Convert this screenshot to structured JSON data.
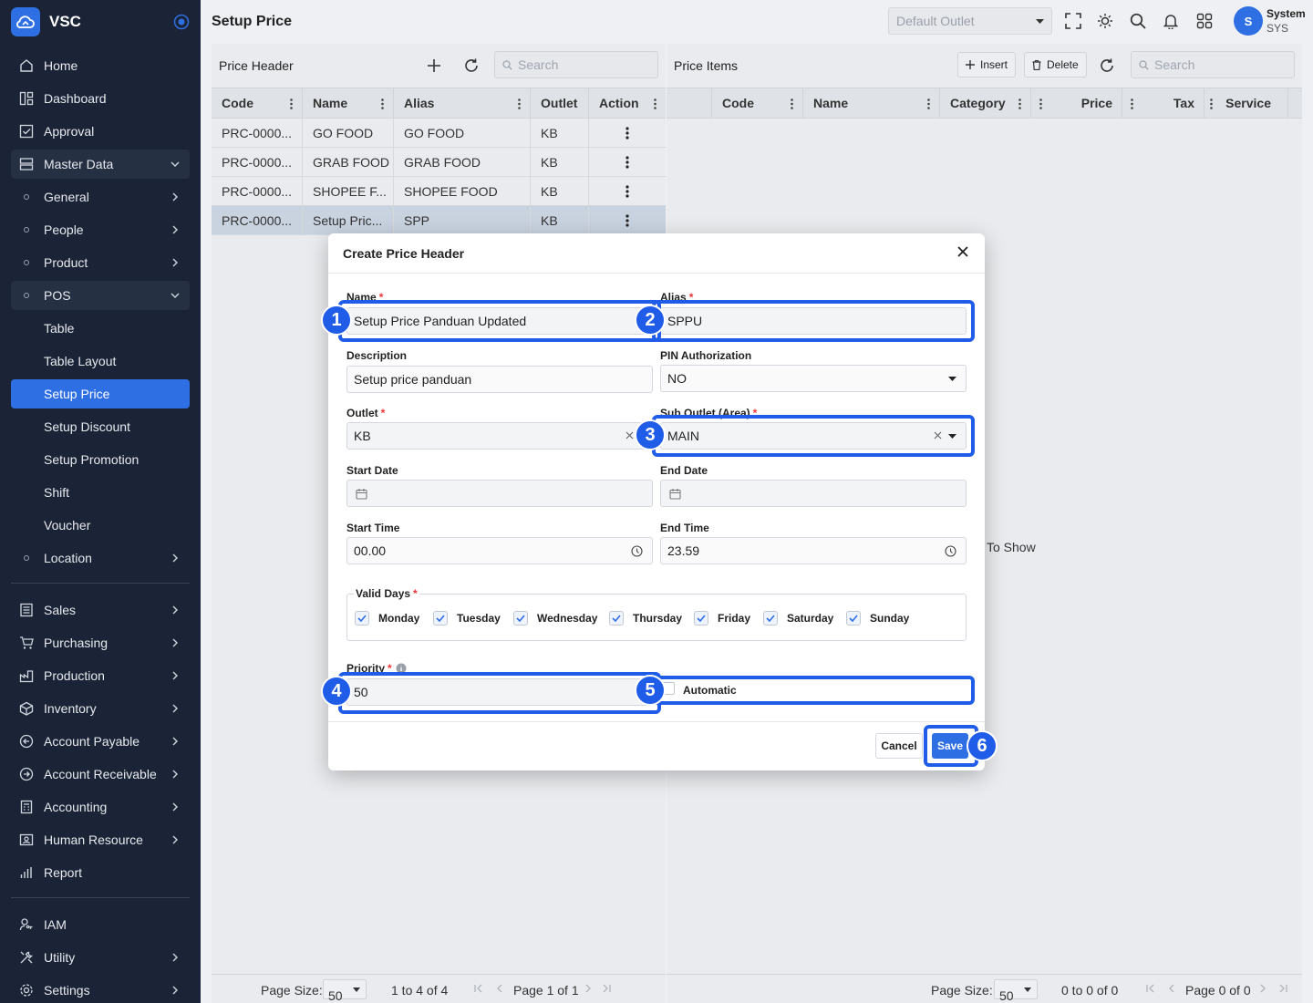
{
  "app": {
    "name": "VSC",
    "page_title": "Setup Price"
  },
  "topbar": {
    "outlet_placeholder": "Default Outlet",
    "user_name": "System",
    "user_code": "SYS",
    "avatar_initial": "S"
  },
  "sidebar": {
    "home": "Home",
    "dashboard": "Dashboard",
    "approval": "Approval",
    "master_data": "Master Data",
    "general": "General",
    "people": "People",
    "product": "Product",
    "pos": "POS",
    "table": "Table",
    "table_layout": "Table Layout",
    "setup_price": "Setup Price",
    "setup_discount": "Setup Discount",
    "setup_promotion": "Setup Promotion",
    "shift": "Shift",
    "voucher": "Voucher",
    "location": "Location",
    "sales": "Sales",
    "purchasing": "Purchasing",
    "production": "Production",
    "inventory": "Inventory",
    "account_payable": "Account Payable",
    "account_receivable": "Account Receivable",
    "accounting": "Accounting",
    "human_resource": "Human Resource",
    "report": "Report",
    "iam": "IAM",
    "utility": "Utility",
    "settings": "Settings"
  },
  "price_header": {
    "title": "Price Header",
    "search_placeholder": "Search",
    "columns": [
      "Code",
      "Name",
      "Alias",
      "Outlet",
      "Action"
    ],
    "rows": [
      {
        "code": "PRC-0000...",
        "name": "GO FOOD",
        "alias": "GO FOOD",
        "outlet": "KB"
      },
      {
        "code": "PRC-0000...",
        "name": "GRAB FOOD",
        "alias": "GRAB FOOD",
        "outlet": "KB"
      },
      {
        "code": "PRC-0000...",
        "name": "SHOPEE F...",
        "alias": "SHOPEE FOOD",
        "outlet": "KB"
      },
      {
        "code": "PRC-0000...",
        "name": "Setup Pric...",
        "alias": "SPP",
        "outlet": "KB"
      }
    ],
    "pager": {
      "page_size_label": "Page Size:",
      "page_size": "50",
      "range": "1 to 4 of 4",
      "page_info": "Page 1 of 1"
    }
  },
  "price_items": {
    "title": "Price Items",
    "insert_label": "Insert",
    "delete_label": "Delete",
    "search_placeholder": "Search",
    "columns": [
      "Code",
      "Name",
      "Category",
      "Price",
      "Tax",
      "Service"
    ],
    "empty_text": "To Show",
    "pager": {
      "page_size_label": "Page Size:",
      "page_size": "50",
      "range": "0 to 0 of 0",
      "page_info": "Page 0 of 0"
    }
  },
  "modal": {
    "title": "Create Price Header",
    "name_label": "Name",
    "name_value": "Setup Price Panduan Updated",
    "alias_label": "Alias",
    "alias_value": "SPPU",
    "description_label": "Description",
    "description_value": "Setup price panduan",
    "pin_label": "PIN Authorization",
    "pin_value": "NO",
    "outlet_label": "Outlet",
    "outlet_value": "KB",
    "sub_outlet_label": "Sub Outlet (Area)",
    "sub_outlet_value": "MAIN",
    "start_date_label": "Start Date",
    "end_date_label": "End Date",
    "start_time_label": "Start Time",
    "start_time_value": "00.00",
    "end_time_label": "End Time",
    "end_time_value": "23.59",
    "valid_days_label": "Valid Days",
    "days": [
      "Monday",
      "Tuesday",
      "Wednesday",
      "Thursday",
      "Friday",
      "Saturday",
      "Sunday"
    ],
    "priority_label": "Priority",
    "priority_value": "50",
    "automatic_label": "Automatic",
    "cancel_label": "Cancel",
    "save_label": "Save"
  },
  "annotations": [
    "1",
    "2",
    "3",
    "4",
    "5",
    "6"
  ],
  "colors": {
    "accent": "#2f6fe4",
    "sidebar_bg": "#1b2436",
    "highlight": "#1f5ce8"
  }
}
